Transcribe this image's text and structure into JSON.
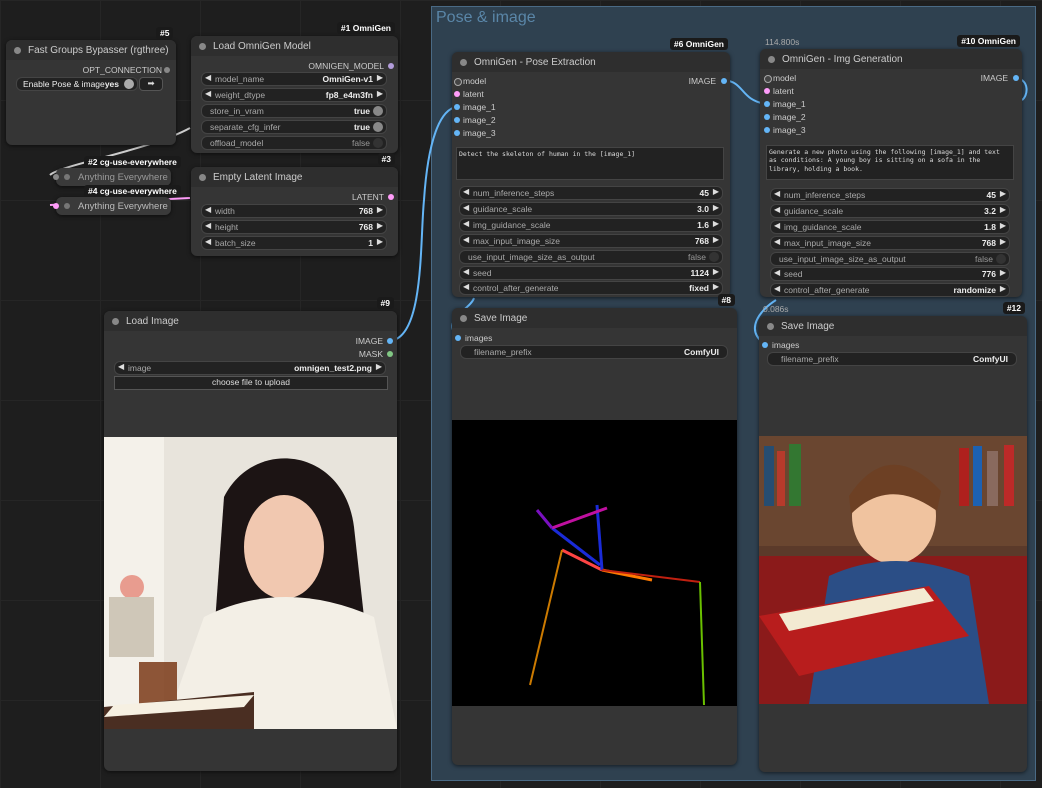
{
  "group": {
    "title": "Pose & image"
  },
  "bypasser": {
    "badge": "#5",
    "title": "Fast Groups Bypasser (rgthree)",
    "output": "OPT_CONNECTION",
    "toggle_label": "Enable Pose & image",
    "toggle_value": "yes"
  },
  "load_model": {
    "badge": "#1 OmniGen",
    "title": "Load OmniGen Model",
    "output": "OMNIGEN_MODEL",
    "widgets": [
      {
        "label": "model_name",
        "value": "OmniGen-v1"
      },
      {
        "label": "weight_dtype",
        "value": "fp8_e4m3fn"
      }
    ],
    "toggles": [
      {
        "label": "store_in_vram",
        "value": "true"
      },
      {
        "label": "separate_cfg_infer",
        "value": "true"
      },
      {
        "label": "offload_model",
        "value": "false"
      }
    ]
  },
  "ae1": {
    "badge": "#2 cg-use-everywhere",
    "title": "Anything Everywhere"
  },
  "ae2": {
    "badge": "#4 cg-use-everywhere",
    "title": "Anything Everywhere"
  },
  "empty_latent": {
    "badge": "#3",
    "title": "Empty Latent Image",
    "output": "LATENT",
    "widgets": [
      {
        "label": "width",
        "value": "768"
      },
      {
        "label": "height",
        "value": "768"
      },
      {
        "label": "batch_size",
        "value": "1"
      }
    ]
  },
  "load_image": {
    "badge": "#9",
    "title": "Load Image",
    "outputs": [
      "IMAGE",
      "MASK"
    ],
    "image_label": "image",
    "image_value": "omnigen_test2.png",
    "upload_label": "choose file to upload"
  },
  "pose": {
    "badge": "#6 OmniGen",
    "title": "OmniGen - Pose Extraction",
    "inputs": [
      "model",
      "latent",
      "image_1",
      "image_2",
      "image_3"
    ],
    "output": "IMAGE",
    "prompt": "Detect the skeleton of human in the [image_1]",
    "widgets": [
      {
        "label": "num_inference_steps",
        "value": "45"
      },
      {
        "label": "guidance_scale",
        "value": "3.0"
      },
      {
        "label": "img_guidance_scale",
        "value": "1.6"
      },
      {
        "label": "max_input_image_size",
        "value": "768"
      }
    ],
    "toggle": {
      "label": "use_input_image_size_as_output",
      "value": "false"
    },
    "widgets2": [
      {
        "label": "seed",
        "value": "1124"
      },
      {
        "label": "control_after_generate",
        "value": "fixed"
      }
    ]
  },
  "gen": {
    "badge": "#10 OmniGen",
    "time": "114.800s",
    "title": "OmniGen - Img Generation",
    "inputs": [
      "model",
      "latent",
      "image_1",
      "image_2",
      "image_3"
    ],
    "output": "IMAGE",
    "prompt": "Generate a new photo using the following [image_1] and text as conditions: A young boy is sitting on a sofa in the library, holding a book.",
    "widgets": [
      {
        "label": "num_inference_steps",
        "value": "45"
      },
      {
        "label": "guidance_scale",
        "value": "3.2"
      },
      {
        "label": "img_guidance_scale",
        "value": "1.8"
      },
      {
        "label": "max_input_image_size",
        "value": "768"
      }
    ],
    "toggle": {
      "label": "use_input_image_size_as_output",
      "value": "false"
    },
    "widgets2": [
      {
        "label": "seed",
        "value": "776"
      },
      {
        "label": "control_after_generate",
        "value": "randomize"
      }
    ]
  },
  "save1": {
    "badge": "#8",
    "title": "Save Image",
    "input": "images",
    "prefix_label": "filename_prefix",
    "prefix_value": "ComfyUI"
  },
  "save2": {
    "badge": "#12",
    "time": "0.086s",
    "title": "Save Image",
    "input": "images",
    "prefix_label": "filename_prefix",
    "prefix_value": "ComfyUI"
  },
  "colors": {
    "group_bg": "#2f4150",
    "node_bg": "#353535",
    "socket_image": "#64b5f6",
    "socket_latent": "#ff9cf9",
    "socket_model": "#b39ddb"
  }
}
